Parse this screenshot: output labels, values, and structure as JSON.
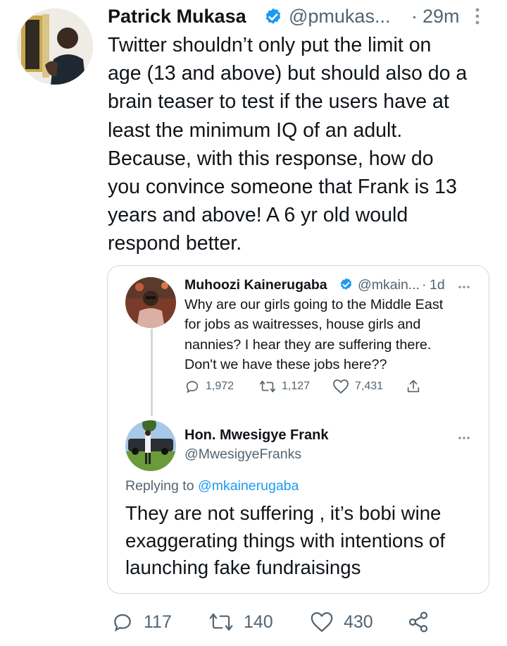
{
  "main_tweet": {
    "author_name": "Patrick Mukasa",
    "handle": "@pmukas...",
    "separator": "·",
    "time": "29m",
    "text_lines": [
      "Twitter shouldn’t only put the limit on",
      "age (13 and above) but should also do a",
      "brain teaser to test if the users have at",
      "least the minimum IQ of an adult.",
      "Because, with this response, how do",
      "you convince someone that Frank is 13",
      "years and above! A 6 yr old would",
      "respond better."
    ],
    "actions": {
      "replies": "117",
      "retweets": "140",
      "likes": "430"
    }
  },
  "quoted_original": {
    "author_name": "Muhoozi Kainerugaba",
    "handle": "@mkain...",
    "separator": "·",
    "time": "1d",
    "text_lines": [
      "Why are our girls going to the Middle East",
      "for jobs as waitresses, house girls and",
      "nannies? I hear they are suffering there.",
      "Don't we have these jobs here??"
    ],
    "actions": {
      "replies": "1,972",
      "retweets": "1,127",
      "likes": "7,431"
    }
  },
  "quoted_reply": {
    "author_name": "Hon. Mwesigye Frank",
    "handle": "@MwesigyeFranks",
    "replying_prefix": "Replying to",
    "replying_to": "@mkainerugaba",
    "text_lines": [
      "They are not suffering , it’s bobi wine",
      "exaggerating things with intentions of",
      "launching fake fundraisings"
    ]
  },
  "colors": {
    "accent": "#1d9bf0",
    "text": "#0f1419",
    "muted": "#536471",
    "border": "#cfd9de"
  },
  "icons": [
    "verified-badge-icon",
    "more-vertical-icon",
    "more-horizontal-icon",
    "reply-icon",
    "retweet-icon",
    "like-icon",
    "share-icon"
  ]
}
